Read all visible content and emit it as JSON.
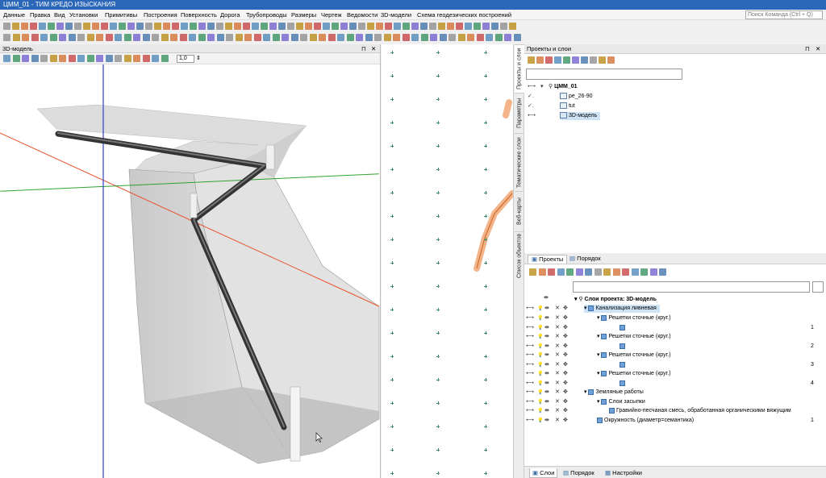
{
  "window": {
    "title": "ЦММ_01 - ТИМ КРЕДО ИЗЫСКАНИЯ"
  },
  "menu": {
    "items": [
      "Данные",
      "Правка",
      "Вид",
      "Установки",
      "Примитивы",
      "Построения",
      "Поверхность",
      "Дорога",
      "Трубопроводы",
      "Размеры",
      "Чертеж",
      "Ведомости",
      "3D-модели",
      "Схема геодезических построений"
    ],
    "search_placeholder": "Поиск Команда (Ctrl + Q)"
  },
  "view3d": {
    "title": "3D-модель",
    "zoom_value": "1,0",
    "colors": {
      "x_axis": "#e8532a",
      "y_axis": "#2ea12e",
      "z_axis": "#2c3fc4"
    }
  },
  "side_tabs": [
    "Проекты и слои",
    "Параметры",
    "Тематические слои",
    "Веб-карты",
    "Список объектов"
  ],
  "projects_panel": {
    "title": "Проекты и слои",
    "tree": [
      {
        "label": "ЦММ_01",
        "bold": true
      },
      {
        "label": "ре_26-90"
      },
      {
        "label": "tut"
      },
      {
        "label": "3D-модель",
        "selected": true
      }
    ]
  },
  "layers_tabs": {
    "projects": "Проекты",
    "order": "Порядок"
  },
  "layers": {
    "root": "Слои проекта: 3D-модель",
    "rows": [
      {
        "label": "Канализация ливневая",
        "selected": true
      },
      {
        "label": "Решетки сточные (круг.)"
      },
      {
        "label": "",
        "num": "1"
      },
      {
        "label": "Решетки сточные (круг.)"
      },
      {
        "label": "",
        "num": "2"
      },
      {
        "label": "Решетки сточные (круг.)"
      },
      {
        "label": "",
        "num": "3"
      },
      {
        "label": "Решетки сточные (круг.)"
      },
      {
        "label": "",
        "num": "4"
      },
      {
        "label": "Земляные работы"
      },
      {
        "label": "Слои засыпки"
      },
      {
        "label": "Гравийно-песчаная смесь, обработанная органическими вяжущим"
      },
      {
        "label": "Окружность (диаметр=семантика)",
        "num": "1"
      }
    ]
  },
  "footer_tabs": {
    "layers": "Слои",
    "order": "Порядок",
    "settings": "Настройки"
  }
}
